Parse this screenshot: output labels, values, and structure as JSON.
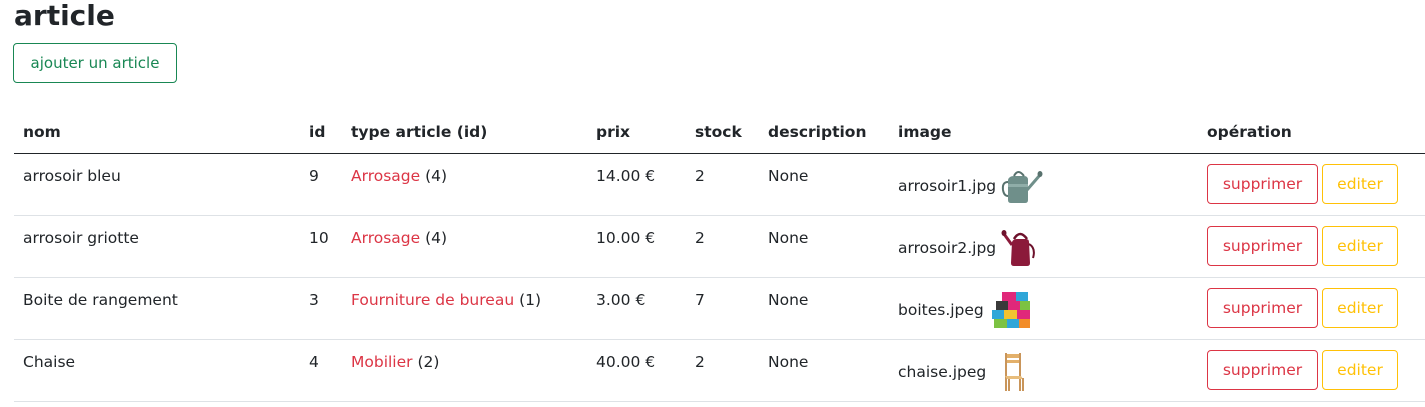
{
  "page": {
    "title": "article",
    "add_button_label": "ajouter un article"
  },
  "table": {
    "headers": {
      "nom": "nom",
      "id": "id",
      "type": "type article (id)",
      "prix": "prix",
      "stock": "stock",
      "description": "description",
      "image": "image",
      "operation": "opération"
    },
    "rows": [
      {
        "nom": "arrosoir bleu",
        "id": "9",
        "type_name": "Arrosage",
        "type_id": "(4)",
        "prix": "14.00 €",
        "stock": "2",
        "description": "None",
        "image": "arrosoir1.jpg",
        "delete_label": "supprimer",
        "edit_label": "editer"
      },
      {
        "nom": "arrosoir griotte",
        "id": "10",
        "type_name": "Arrosage",
        "type_id": "(4)",
        "prix": "10.00 €",
        "stock": "2",
        "description": "None",
        "image": "arrosoir2.jpg",
        "delete_label": "supprimer",
        "edit_label": "editer"
      },
      {
        "nom": "Boite de rangement",
        "id": "3",
        "type_name": "Fourniture de bureau",
        "type_id": "(1)",
        "prix": "3.00 €",
        "stock": "7",
        "description": "None",
        "image": "boites.jpeg",
        "delete_label": "supprimer",
        "edit_label": "editer"
      },
      {
        "nom": "Chaise",
        "id": "4",
        "type_name": "Mobilier",
        "type_id": "(2)",
        "prix": "40.00 €",
        "stock": "2",
        "description": "None",
        "image": "chaise.jpeg",
        "delete_label": "supprimer",
        "edit_label": "editer"
      }
    ]
  },
  "colors": {
    "success": "#198754",
    "danger": "#dc3545",
    "warning": "#ffc107",
    "text": "#212529"
  }
}
